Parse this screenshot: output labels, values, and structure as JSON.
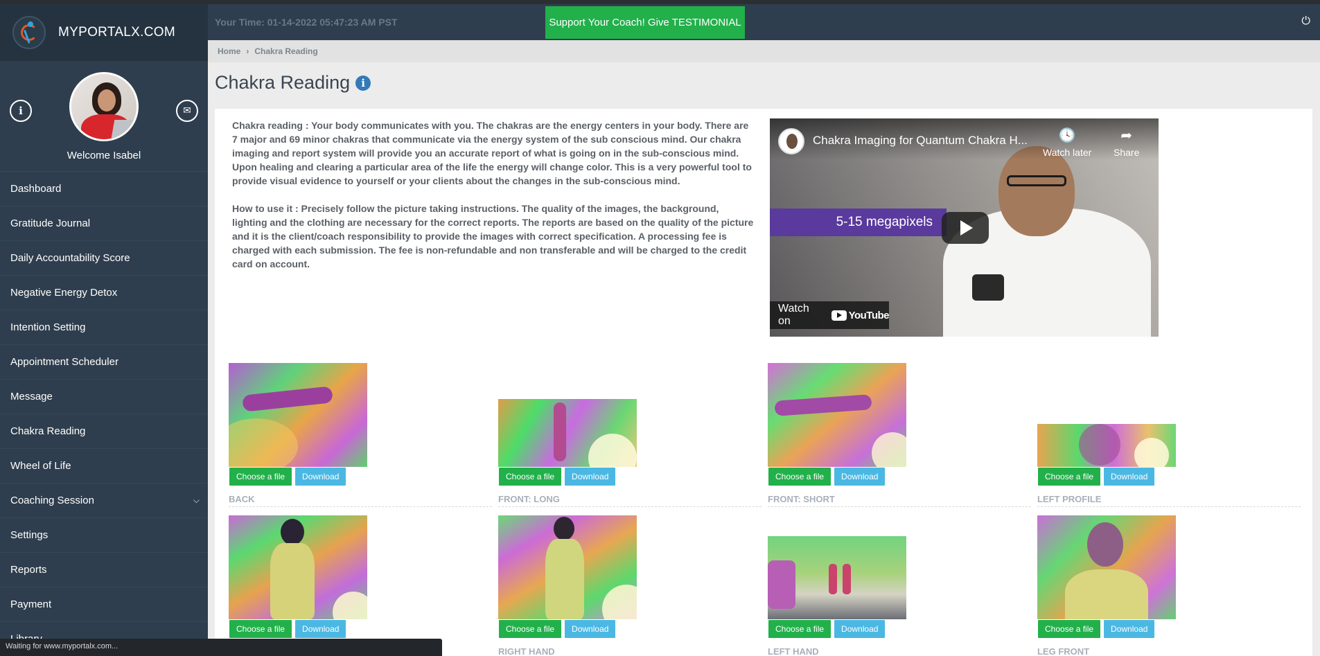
{
  "brand": {
    "name": "MYPORTALX.COM"
  },
  "profile": {
    "welcome": "Welcome Isabel"
  },
  "sidebar": {
    "items": [
      {
        "label": "Dashboard"
      },
      {
        "label": "Gratitude Journal"
      },
      {
        "label": "Daily Accountability Score"
      },
      {
        "label": "Negative Energy Detox"
      },
      {
        "label": "Intention Setting"
      },
      {
        "label": "Appointment Scheduler"
      },
      {
        "label": "Message"
      },
      {
        "label": "Chakra Reading"
      },
      {
        "label": "Wheel of Life"
      },
      {
        "label": "Coaching Session"
      },
      {
        "label": "Settings"
      },
      {
        "label": "Reports"
      },
      {
        "label": "Payment"
      },
      {
        "label": "Library"
      }
    ]
  },
  "header": {
    "time": "Your Time: 01-14-2022 05:47:23 AM PST",
    "support": "Support Your Coach! Give TESTIMONIAL"
  },
  "breadcrumb": {
    "home": "Home",
    "current": "Chakra Reading"
  },
  "page": {
    "title": "Chakra Reading",
    "desc1": "Chakra reading : Your body communicates with you. The chakras are the energy centers in your body. There are 7 major and 69 minor chakras that communicate via the energy system of the sub conscious mind. Our chakra imaging and report system will provide you an accurate report of what is going on in the sub-conscious mind. Upon healing and clearing a particular area of the life the energy will change color. This is a very powerful tool to provide visual evidence to yourself or your clients about the changes in the sub-conscious mind.",
    "desc2": "How to use it : Precisely follow the picture taking instructions. The quality of the images, the background, lighting and the clothing are necessary for the correct reports. The reports are based on the quality of the picture and it is the client/coach responsibility to provide the images with correct specification. A processing fee is charged with each submission. The fee is non-refundable and non transferable and will be charged to the credit card on account."
  },
  "video": {
    "title": "Chakra Imaging for Quantum Chakra H...",
    "watch_later": "Watch later",
    "share": "Share",
    "overlay_text": "5-15 megapixels",
    "watch_on": "Watch on",
    "youtube": "YouTube"
  },
  "uploads": {
    "choose_label": "Choose a file",
    "download_label": "Download",
    "items": [
      {
        "label": "BACK"
      },
      {
        "label": "FRONT: LONG"
      },
      {
        "label": "FRONT: SHORT"
      },
      {
        "label": "LEFT PROFILE"
      },
      {
        "label": ""
      },
      {
        "label": "RIGHT HAND"
      },
      {
        "label": "LEFT HAND"
      },
      {
        "label": "LEG FRONT"
      }
    ]
  },
  "statusbar": {
    "text": "Waiting for www.myportalx.com..."
  },
  "colors": {
    "sidebar": "#2f3e4e",
    "accent_green": "#22b04b",
    "accent_blue": "#4bb8e3",
    "info_blue": "#337ab7"
  },
  "icons": [
    "info-icon",
    "mail-icon",
    "power-icon",
    "chevron-down-icon",
    "play-icon",
    "clock-icon",
    "share-icon"
  ]
}
